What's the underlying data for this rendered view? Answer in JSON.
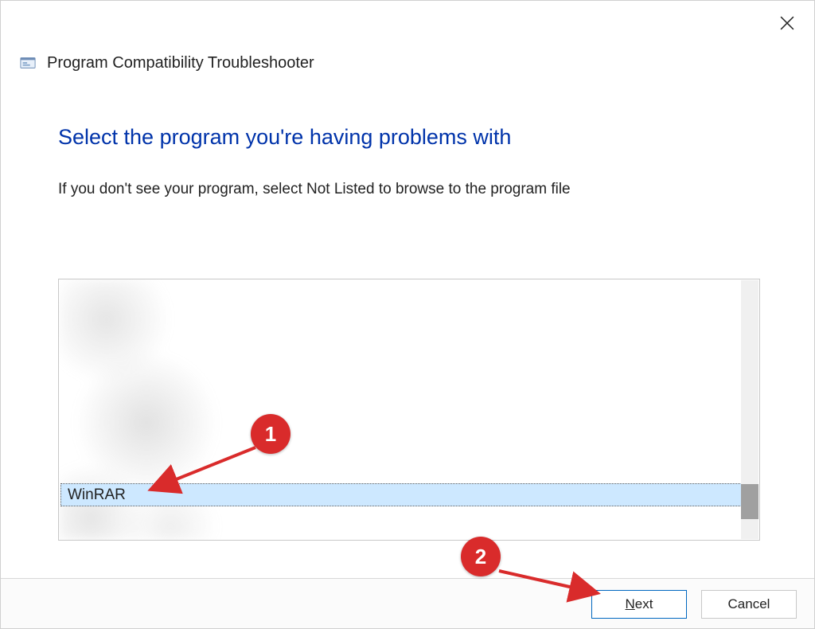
{
  "window": {
    "title": "Program Compatibility Troubleshooter"
  },
  "heading": "Select the program you're having problems with",
  "subtext": "If you don't see your program, select Not Listed to browse to the program file",
  "list": {
    "selected": "WinRAR"
  },
  "buttons": {
    "next_prefix": "N",
    "next_rest": "ext",
    "cancel": "Cancel"
  },
  "annotations": {
    "callout1": "1",
    "callout2": "2"
  }
}
